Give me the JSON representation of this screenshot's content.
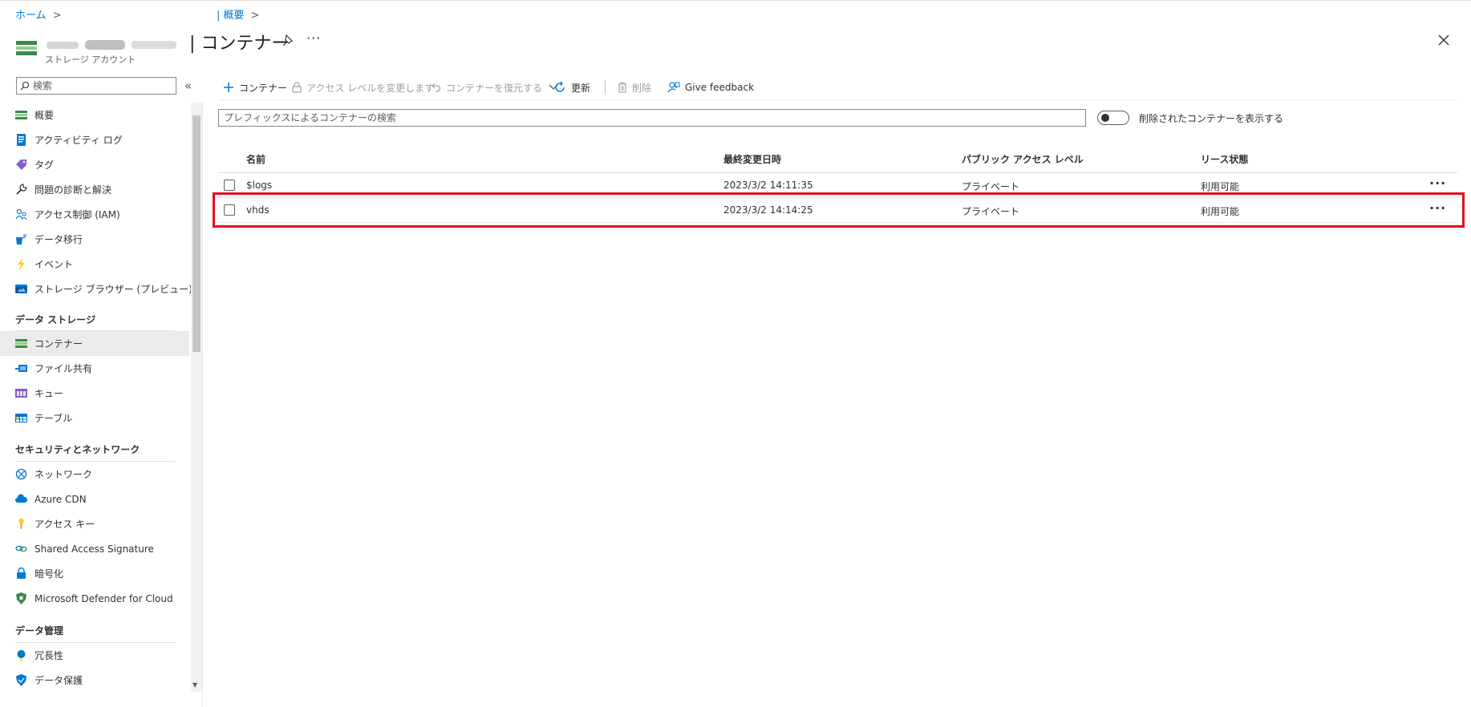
{
  "breadcrumb": {
    "home": "ホーム",
    "overview": "| 概要",
    "separator": ">"
  },
  "header": {
    "title": "| コンテナー",
    "subtitle": "ストレージ アカウント",
    "more": "···"
  },
  "sidebar": {
    "search_placeholder": "検索",
    "collapse": "«",
    "items": [
      {
        "label": "概要",
        "icon": "overview-icon"
      },
      {
        "label": "アクティビティ ログ",
        "icon": "activity-log-icon"
      },
      {
        "label": "タグ",
        "icon": "tag-icon"
      },
      {
        "label": "問題の診断と解決",
        "icon": "wrench-icon"
      },
      {
        "label": "アクセス制御 (IAM)",
        "icon": "people-icon"
      },
      {
        "label": "データ移行",
        "icon": "data-migration-icon"
      },
      {
        "label": "イベント",
        "icon": "lightning-icon"
      },
      {
        "label": "ストレージ ブラウザー (プレビュー)",
        "icon": "storage-browser-icon"
      }
    ],
    "sections": [
      {
        "heading": "データ ストレージ",
        "items": [
          {
            "label": "コンテナー",
            "icon": "container-icon",
            "active": true
          },
          {
            "label": "ファイル共有",
            "icon": "file-share-icon"
          },
          {
            "label": "キュー",
            "icon": "queue-icon"
          },
          {
            "label": "テーブル",
            "icon": "table-icon"
          }
        ]
      },
      {
        "heading": "セキュリティとネットワーク",
        "items": [
          {
            "label": "ネットワーク",
            "icon": "network-icon"
          },
          {
            "label": "Azure CDN",
            "icon": "cloud-icon"
          },
          {
            "label": "アクセス キー",
            "icon": "key-icon"
          },
          {
            "label": "Shared Access Signature",
            "icon": "link-icon"
          },
          {
            "label": "暗号化",
            "icon": "lock-icon"
          },
          {
            "label": "Microsoft Defender for Cloud",
            "icon": "shield-icon"
          }
        ]
      },
      {
        "heading": "データ管理",
        "items": [
          {
            "label": "冗長性",
            "icon": "globe-icon"
          },
          {
            "label": "データ保護",
            "icon": "protection-shield-icon"
          }
        ]
      }
    ]
  },
  "toolbar": {
    "add_container": "コンテナー",
    "change_access_level": "アクセス レベルを変更します",
    "restore_containers": "コンテナーを復元する",
    "refresh": "更新",
    "delete": "削除",
    "feedback": "Give feedback"
  },
  "filter": {
    "placeholder": "プレフィックスによるコンテナーの検索",
    "toggle_label": "削除されたコンテナーを表示する",
    "toggle_on": false
  },
  "table": {
    "columns": [
      "名前",
      "最終変更日時",
      "パブリック アクセス レベル",
      "リース状態"
    ],
    "rows": [
      {
        "name": "$logs",
        "modified": "2023/3/2 14:11:35",
        "access": "プライベート",
        "lease": "利用可能"
      },
      {
        "name": "vhds",
        "modified": "2023/3/2 14:14:25",
        "access": "プライベート",
        "lease": "利用可能"
      }
    ],
    "row_more": "···"
  },
  "colors": {
    "accent": "#0078d4",
    "highlight_border": "#e30b1c",
    "active_nav": "#edebe9"
  }
}
